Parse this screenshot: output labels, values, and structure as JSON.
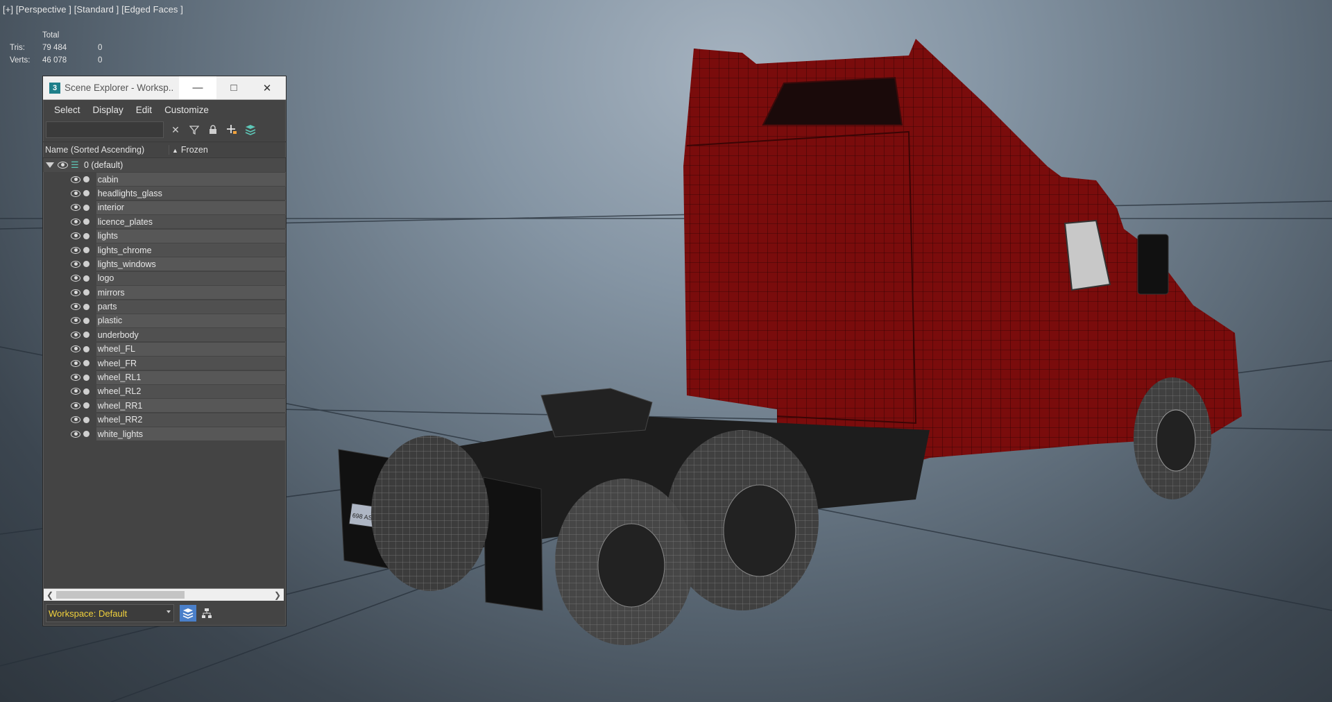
{
  "viewport": {
    "label": "[+] [Perspective ] [Standard ] [Edged Faces ]",
    "stats": {
      "header": "Total",
      "rows": [
        {
          "label": "Tris:",
          "value": "79 484",
          "selected": "0"
        },
        {
          "label": "Verts:",
          "value": "46 078",
          "selected": "0"
        }
      ]
    }
  },
  "scene_explorer": {
    "title": "Scene Explorer - Worksp...",
    "app_icon": "3",
    "menu": [
      "Select",
      "Display",
      "Edit",
      "Customize"
    ],
    "search": {
      "placeholder": "",
      "value": ""
    },
    "columns": {
      "name": "Name (Sorted Ascending)",
      "frozen": "Frozen",
      "sort_indicator": "▲"
    },
    "root_layer": "0 (default)",
    "objects": [
      "cabin",
      "headlights_glass",
      "interior",
      "licence_plates",
      "lights",
      "lights_chrome",
      "lights_windows",
      "logo",
      "mirrors",
      "parts",
      "plastic",
      "underbody",
      "wheel_FL",
      "wheel_FR",
      "wheel_RL1",
      "wheel_RL2",
      "wheel_RR1",
      "wheel_RR2",
      "white_lights"
    ],
    "workspace": "Workspace: Default",
    "icons": {
      "clear": "close-icon",
      "filter": "filter-icon",
      "lock": "lock-icon",
      "add": "add-icon",
      "layers": "layers-icon"
    },
    "colors": {
      "workspace_text": "#f2d23c",
      "active_button": "#4a7fc9",
      "layer_icon": "#5ec8b8"
    }
  },
  "model": {
    "body_color": "#7a0c0c",
    "plate_text": "698 AS1"
  }
}
